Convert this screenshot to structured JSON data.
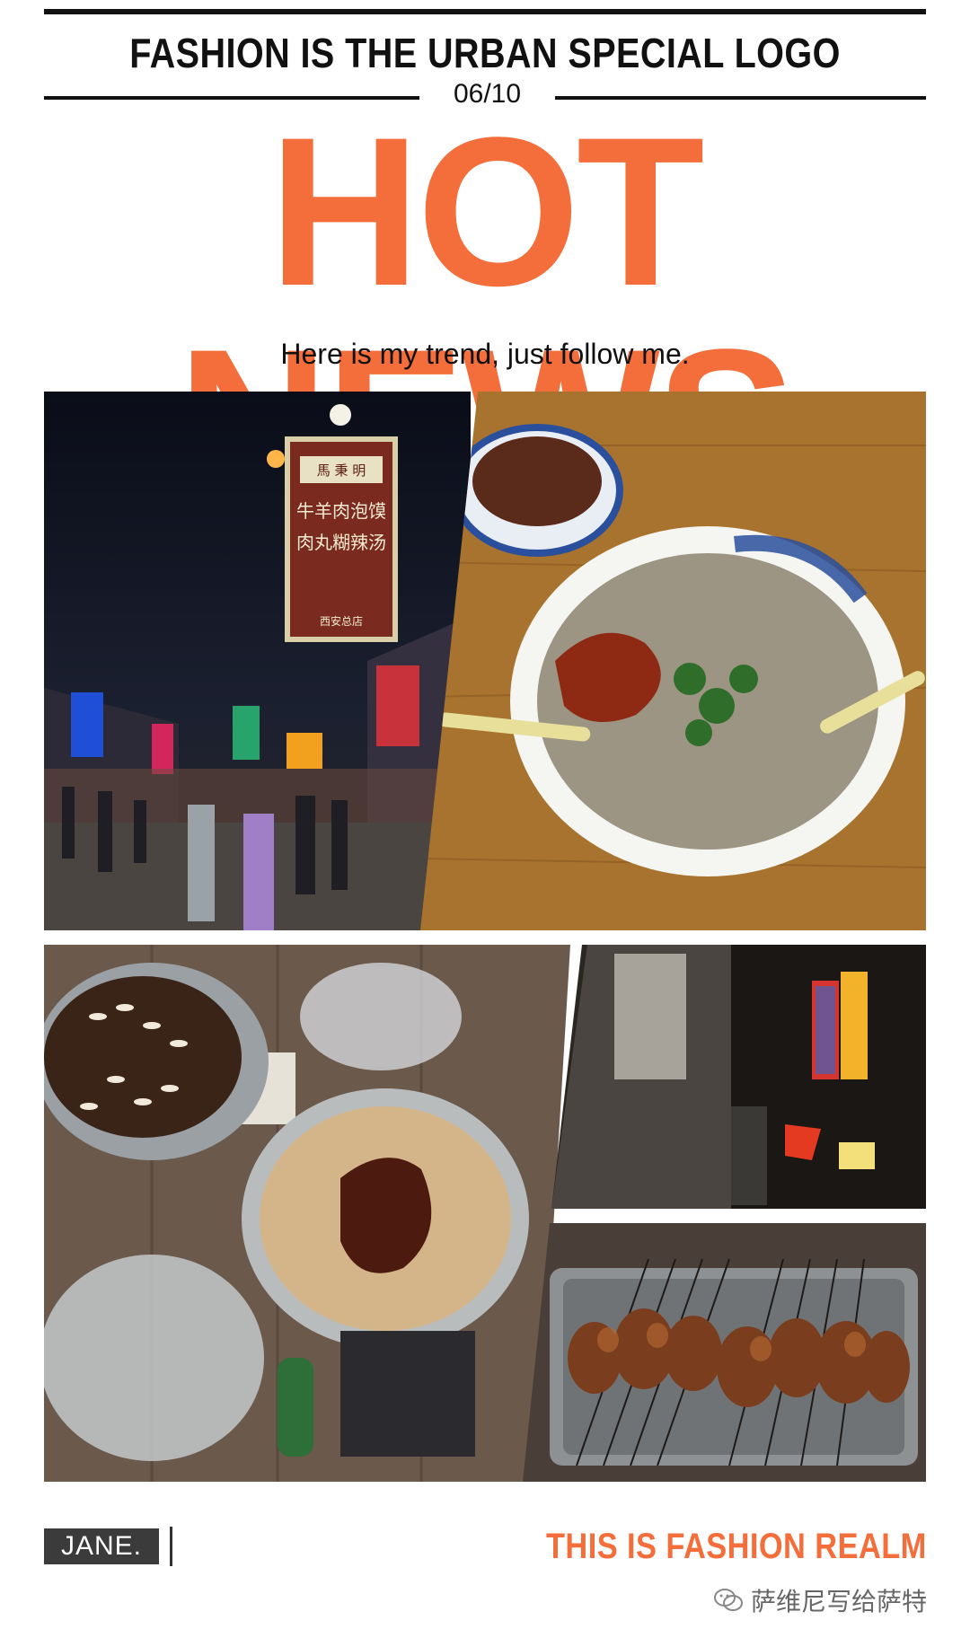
{
  "header": {
    "kicker": "FASHION IS THE URBAN SPECIAL LOGO",
    "date": "06/10",
    "headline": "HOT NEWS",
    "tagline": "Here is my trend, just follow me."
  },
  "photos": [
    {
      "name": "night-market-street",
      "sign_lines": [
        "馬 秉 明",
        "牛 羊 肉 泡 馍",
        "肉 丸 糊 辣 汤",
        "西安总店"
      ]
    },
    {
      "name": "soup-bowl-with-chili"
    },
    {
      "name": "noodle-bowls-table"
    },
    {
      "name": "alley-neon-signs"
    },
    {
      "name": "lamb-skewers-tray"
    }
  ],
  "footer": {
    "brand": "JANE.",
    "title": "THIS IS FASHION REALM",
    "watermark": "萨维尼写给萨特"
  },
  "colors": {
    "accent": "#f36e3a",
    "ink": "#111111",
    "brand_box": "#3b3b3b"
  }
}
